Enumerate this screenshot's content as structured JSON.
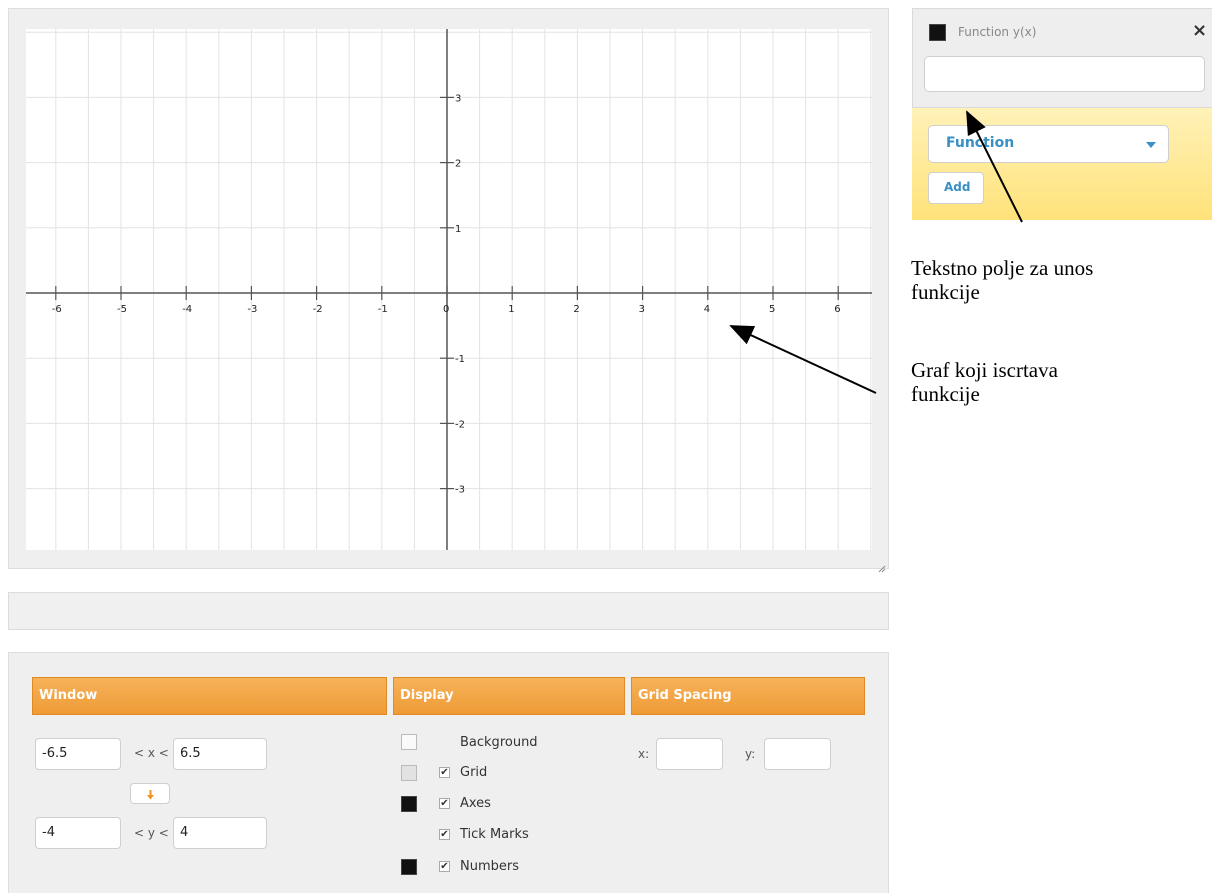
{
  "graph": {
    "x_ticks": [
      "-6",
      "-5",
      "-4",
      "-3",
      "-2",
      "-1",
      "0",
      "1",
      "2",
      "3",
      "4",
      "5",
      "6"
    ],
    "y_ticks_pos": [
      "3",
      "2",
      "1"
    ],
    "y_ticks_neg": [
      "-1",
      "-2",
      "-3"
    ],
    "x_range": [
      -6.5,
      6.5
    ],
    "y_range": [
      -4,
      4
    ],
    "grid_color": "#e3e3e3",
    "axis_color": "#555555"
  },
  "settings": {
    "window_header": "Window",
    "display_header": "Display",
    "grid_spacing_header": "Grid Spacing",
    "xmin": "-6.5",
    "xmax": "6.5",
    "x_between": "< x <",
    "ymin": "-4",
    "ymax": "4",
    "y_between": "< y <",
    "swap_icon": "arrow-down-icon",
    "display_options": [
      {
        "label": "Background",
        "checked": false
      },
      {
        "label": "Grid",
        "checked": true
      },
      {
        "label": "Axes",
        "checked": true
      },
      {
        "label": "Tick Marks",
        "checked": true
      },
      {
        "label": "Numbers",
        "checked": true
      }
    ],
    "check_mark": "✔",
    "gs_x_label": "x:",
    "gs_y_label": "y:",
    "gs_x_value": "",
    "gs_y_value": ""
  },
  "function_panel": {
    "title": "Function y(x)",
    "close_glyph": "×",
    "input_value": "",
    "type_select": "Function",
    "add_label": "Add",
    "accent_color": "#3a8fc4"
  },
  "annotations": {
    "input_note_line1": "Tekstno polje za unos",
    "input_note_line2": "funkcije",
    "graph_note_line1": "Graf koji iscrtava",
    "graph_note_line2": "funkcije"
  }
}
